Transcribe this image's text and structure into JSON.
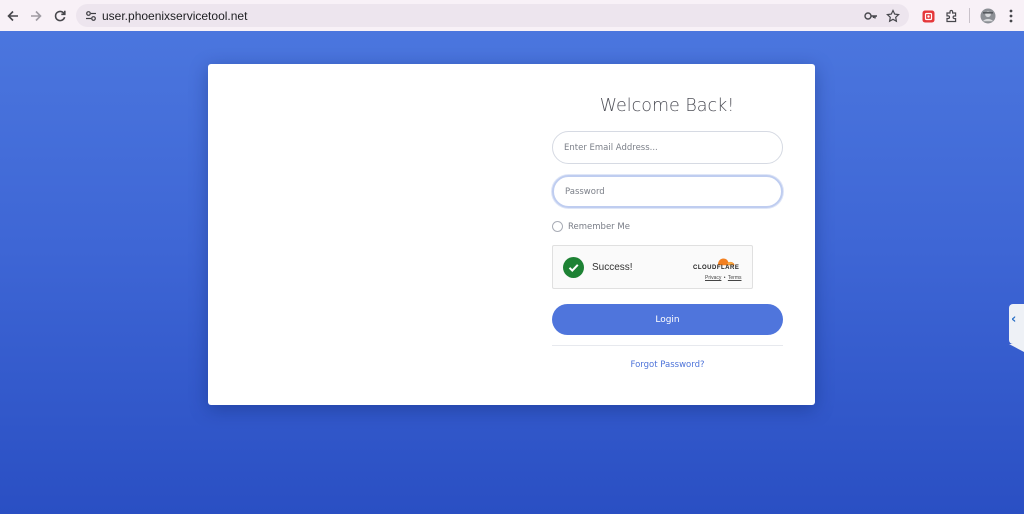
{
  "browser": {
    "url": "user.phoenixservicetool.net",
    "icons": {
      "back": "arrow-left-icon",
      "forward": "arrow-right-icon",
      "reload": "reload-icon",
      "site_info": "tune-icon",
      "password_key": "key-icon",
      "bookmark": "star-icon",
      "extension": "extension-red-icon",
      "extensions_menu": "puzzle-icon",
      "profile": "avatar-icon",
      "menu": "kebab-icon"
    }
  },
  "login": {
    "title": "Welcome Back!",
    "email_placeholder": "Enter Email Address...",
    "password_placeholder": "Password",
    "remember_label": "Remember Me",
    "captcha": {
      "status": "Success!",
      "brand": "CLOUDFLARE",
      "privacy": "Privacy",
      "separator": "•",
      "terms": "Terms"
    },
    "login_label": "Login",
    "forgot_label": "Forgot Password?"
  },
  "colors": {
    "background_top": "#4b76de",
    "background_bottom": "#2a4fc3",
    "button": "#4f75dc",
    "link": "#4d73d9",
    "success": "#1d8234",
    "cloudflare": "#f38020"
  }
}
